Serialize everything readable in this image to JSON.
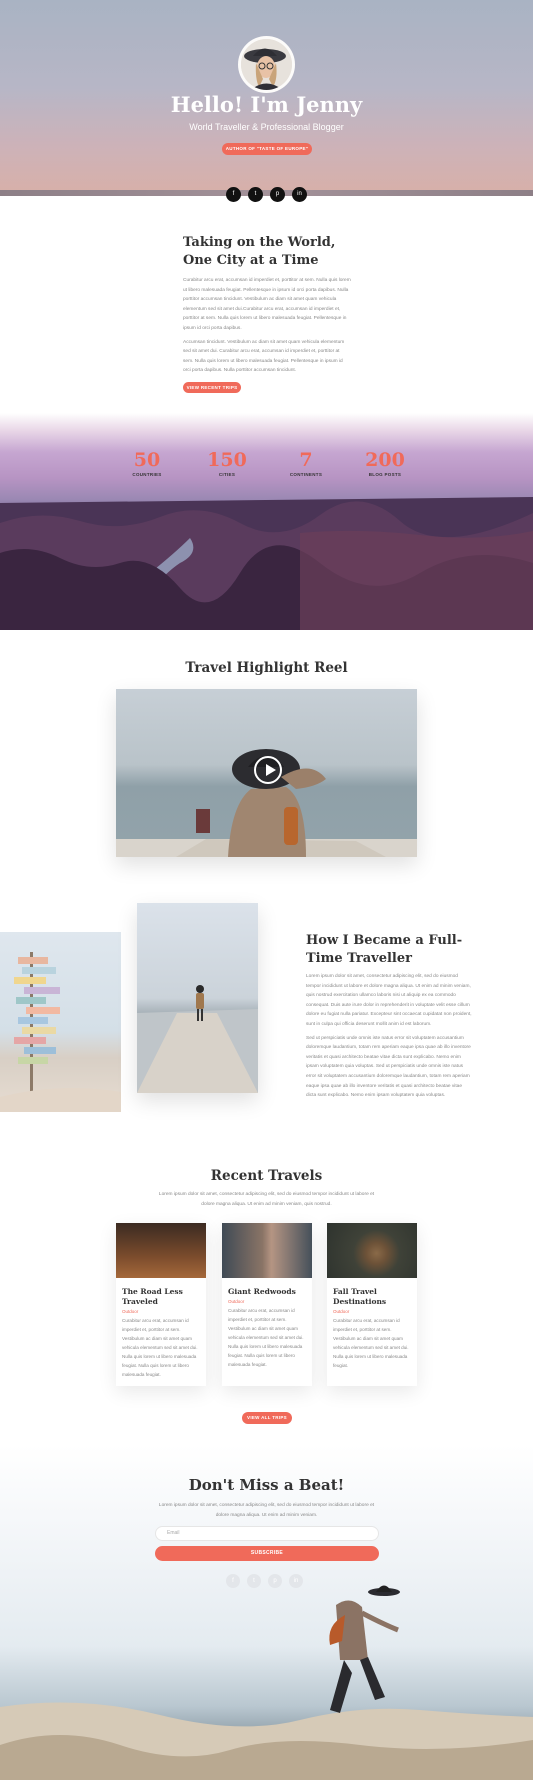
{
  "hero": {
    "title": "Hello! I'm Jenny",
    "subtitle": "World Traveller & Professional Blogger",
    "button": "AUTHOR OF \"TASTE OF EUROPE\"",
    "social": [
      "f",
      "t",
      "p",
      "in"
    ]
  },
  "intro": {
    "title": "Taking on the World, One City at a Time",
    "para1": "Curabitur arcu erat, accumsan id imperdiet et, porttitor at sem. Nulla quis lorem ut libero malesuada feugiat. Pellentesque in ipsum id orci porta dapibus. Nulla porttitor accumsan tincidunt. Vestibulum ac diam sit amet quam vehicula elementum sed sit amet dui.Curabitur arcu erat, accumsan id imperdiet et, porttitor at sem. Nulla quis lorem ut libero malesuada feugiat. Pellentesque in ipsum id orci porta dapibus.",
    "para2": "Accumsan tincidunt. Vestibulum ac diam sit amet quam vehicula elementum sed sit amet dui. Curabitur arcu erat, accumsan id imperdiet et, porttitor at sem. Nulla quis lorem ut libero malesuada feugiat. Pellentesque in ipsum id orci porta dapibus. Nulla porttitor accumsan tincidunt.",
    "button": "VIEW RECENT TRIPS"
  },
  "stats": [
    {
      "num": "50",
      "label": "COUNTRIES"
    },
    {
      "num": "150",
      "label": "CITIES"
    },
    {
      "num": "7",
      "label": "CONTINENTS"
    },
    {
      "num": "200",
      "label": "BLOG POSTS"
    }
  ],
  "video": {
    "title": "Travel Highlight Reel"
  },
  "story": {
    "title": "How I Became a Full-Time Traveller",
    "para1": "Lorem ipsum dolor sit amet, consectetur adipiscing elit, sed do eiusmod tempor incididunt ut labore et dolore magna aliqua. Ut enim ad minim veniam, quis nostrud exercitation ullamco laboris nisi ut aliquip ex ea commodo consequat. Duis aute irure dolor in reprehenderit in voluptate velit esse cillum dolore eu fugiat nulla pariatur. Excepteur sint occaecat cupidatat non proident, sunt in culpa qui officia deserunt mollit anim id est laborum.",
    "para2": "Sed ut perspiciatis unde omnis iste natus error sit voluptatem accusantium doloremque laudantium, totam rem aperiam eaque ipsa quae ab illo inventore veritatis et quasi architecto beatae vitae dicta sunt explicabo. Nemo enim ipsam voluptatem quia voluptas. Sed ut perspiciatis unde omnis iste natus error sit voluptatem accusantium doloremque laudantium, totam rem aperiam eaque ipsa quae ab illo inventore veritatis et quasi architecto beatae vitae dicta sunt explicabo. Nemo enim ipsam voluptatem quia voluptas."
  },
  "recent": {
    "title": "Recent Travels",
    "subtitle": "Lorem ipsum dolor sit amet, consectetur adipiscing elit, sed do eiusmod tempor incididunt ut labore et dolore magna aliqua. Ut enim ad minim veniam, quis nostrud.",
    "cards": [
      {
        "title": "The Road Less Traveled",
        "category": "Outdoor",
        "text": "Curabitur arcu erat, accumsan id imperdiet et, porttitor at sem. Vestibulum ac diam sit amet quam vehicula elementum sed sit amet dui. Nulla quis lorem ut libero malesuada feugiat. Nulla quis lorem ut libero malesuada feugiat."
      },
      {
        "title": "Giant Redwoods",
        "category": "Outdoor",
        "text": "Curabitur arcu erat, accumsan id imperdiet et, porttitor at sem. Vestibulum ac diam sit amet quam vehicula elementum sed sit amet dui. Nulla quis lorem ut libero malesuada feugiat. Nulla quis lorem ut libero malesuada feugiat."
      },
      {
        "title": "Fall Travel Destinations",
        "category": "Outdoor",
        "text": "Curabitur arcu erat, accumsan id imperdiet et, porttitor at sem. Vestibulum ac diam sit amet quam vehicula elementum sed sit amet dui. Nulla quis lorem ut libero malesuada feugiat."
      }
    ],
    "button": "VIEW ALL TRIPS"
  },
  "newsletter": {
    "title": "Don't Miss a Beat!",
    "subtitle": "Lorem ipsum dolor sit amet, consectetur adipiscing elit, sed do eiusmod tempor incididunt ut labore et dolore magna aliqua. Ut enim ad minim veniam.",
    "email_placeholder": "Email",
    "button": "SUBSCRIBE",
    "social": [
      "f",
      "t",
      "p",
      "in"
    ]
  },
  "colors": {
    "accent": "#f06a5a",
    "heading": "#333333",
    "body": "#888888"
  }
}
